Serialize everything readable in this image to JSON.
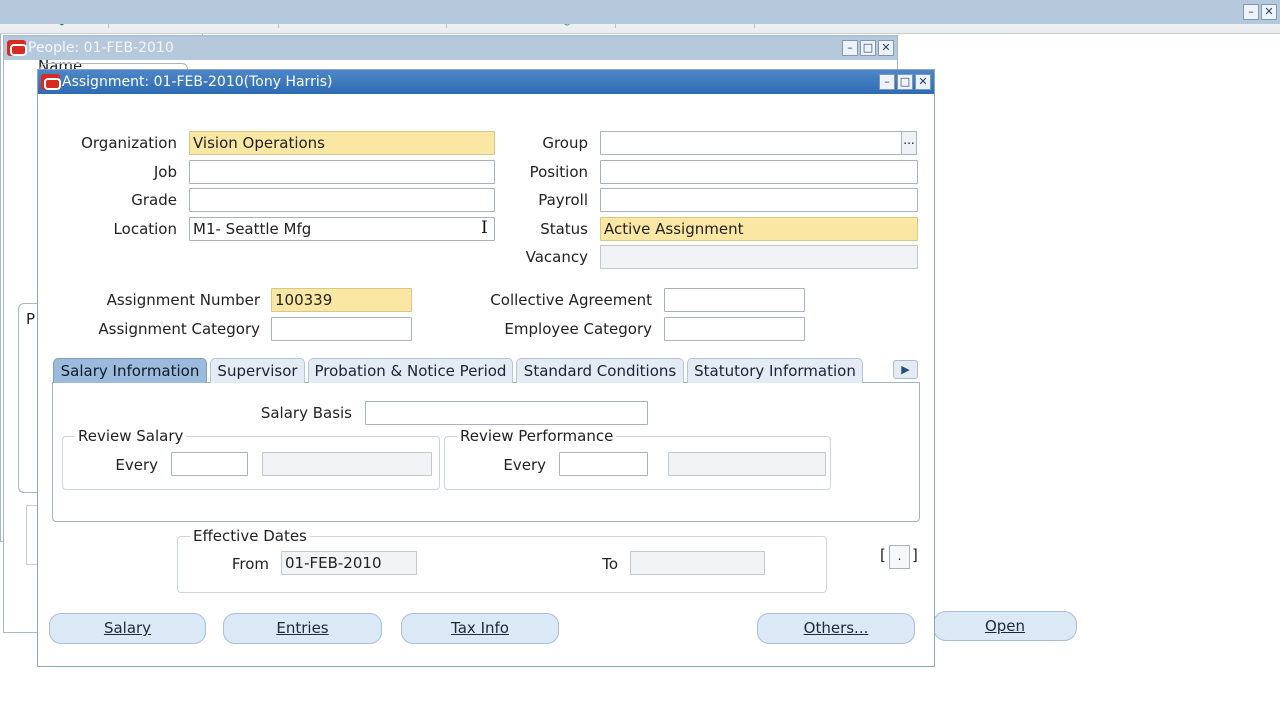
{
  "toolbar": {
    "icons": [
      "new-record-icon",
      "find-icon",
      "navigate-icon",
      "save-icon",
      "clear-icon",
      "switch-responsibility-icon",
      "print-icon",
      "close-form-icon",
      "cut-icon",
      "copy-icon",
      "paste-icon",
      "clear-record-icon",
      "delete-record-icon",
      "edit-field-icon",
      "zoom-icon",
      "translations-icon",
      "attachments-icon",
      "folder-tools-icon",
      "calendar-icon",
      "date-track-icon",
      "export-icon",
      "inbox-icon",
      "help-icon"
    ]
  },
  "people_window": {
    "title": "People: 01-FEB-2010",
    "name_label": "Name",
    "p_label": "P"
  },
  "right_window": {
    "open_label": "Open"
  },
  "assignment_window": {
    "title": "Assignment: 01-FEB-2010(Tony Harris)",
    "organization": {
      "label": "Organization",
      "value": "Vision Operations"
    },
    "job": {
      "label": "Job",
      "value": ""
    },
    "grade": {
      "label": "Grade",
      "value": ""
    },
    "location": {
      "label": "Location",
      "value": "M1- Seattle Mfg"
    },
    "group": {
      "label": "Group",
      "value": "",
      "lov": "..."
    },
    "position": {
      "label": "Position",
      "value": ""
    },
    "payroll": {
      "label": "Payroll",
      "value": ""
    },
    "status": {
      "label": "Status",
      "value": "Active Assignment"
    },
    "vacancy": {
      "label": "Vacancy",
      "value": ""
    },
    "assignment_number": {
      "label": "Assignment Number",
      "value": "100339"
    },
    "assignment_category": {
      "label": "Assignment Category",
      "value": ""
    },
    "collective_agreement": {
      "label": "Collective Agreement",
      "value": ""
    },
    "employee_category": {
      "label": "Employee Category",
      "value": ""
    },
    "tabs": [
      {
        "label": "Salary Information",
        "active": true
      },
      {
        "label": "Supervisor",
        "active": false
      },
      {
        "label": "Probation & Notice Period",
        "active": false
      },
      {
        "label": "Standard Conditions",
        "active": false
      },
      {
        "label": "Statutory Information",
        "active": false
      }
    ],
    "salary_basis": {
      "label": "Salary Basis",
      "value": ""
    },
    "review_salary": {
      "title": "Review Salary",
      "every_label": "Every",
      "every_value": "",
      "unit_value": ""
    },
    "review_performance": {
      "title": "Review Performance",
      "every_label": "Every",
      "every_value": "",
      "unit_value": ""
    },
    "effective_dates": {
      "title": "Effective Dates",
      "from_label": "From",
      "from_value": "01-FEB-2010",
      "to_label": "To",
      "to_value": ""
    },
    "bracket_left": "[",
    "bracket_value": ".",
    "bracket_right": "]",
    "buttons": {
      "salary": "Salary",
      "entries": "Entries",
      "tax_info": "Tax Info",
      "others": "Others..."
    }
  },
  "colors": {
    "title_bar": "#2e6bb3",
    "required_field": "#fbe7a4",
    "active_tab": "#9cbbdc",
    "button": "#dbe8f5"
  }
}
